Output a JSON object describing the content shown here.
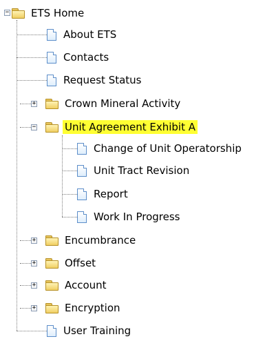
{
  "tree": {
    "root": {
      "label": "ETS Home",
      "expanded": true,
      "toggle_symbol": "−"
    },
    "items": [
      {
        "label": "About ETS",
        "icon": "document-icon"
      },
      {
        "label": "Contacts",
        "icon": "document-icon"
      },
      {
        "label": "Request Status",
        "icon": "document-icon"
      },
      {
        "label": "Crown Mineral Activity",
        "icon": "folder-icon",
        "expanded": false,
        "toggle_symbol": "+"
      },
      {
        "label": "Unit Agreement Exhibit A",
        "icon": "folder-icon",
        "expanded": true,
        "toggle_symbol": "−",
        "selected": true,
        "children": [
          {
            "label": "Change of Unit Operatorship",
            "icon": "document-icon"
          },
          {
            "label": "Unit Tract Revision",
            "icon": "document-icon"
          },
          {
            "label": "Report",
            "icon": "document-icon"
          },
          {
            "label": "Work In Progress",
            "icon": "document-icon"
          }
        ]
      },
      {
        "label": "Encumbrance",
        "icon": "folder-icon",
        "expanded": false,
        "toggle_symbol": "+"
      },
      {
        "label": "Offset",
        "icon": "folder-icon",
        "expanded": false,
        "toggle_symbol": "+"
      },
      {
        "label": "Account",
        "icon": "folder-icon",
        "expanded": false,
        "toggle_symbol": "+"
      },
      {
        "label": "Encryption",
        "icon": "folder-icon",
        "expanded": false,
        "toggle_symbol": "+"
      },
      {
        "label": "User Training",
        "icon": "document-icon"
      }
    ],
    "colors": {
      "selection": "#ffff33",
      "folder": "#f0cf63",
      "document_border": "#5b8dc9",
      "connector": "#7a7a7a"
    }
  }
}
